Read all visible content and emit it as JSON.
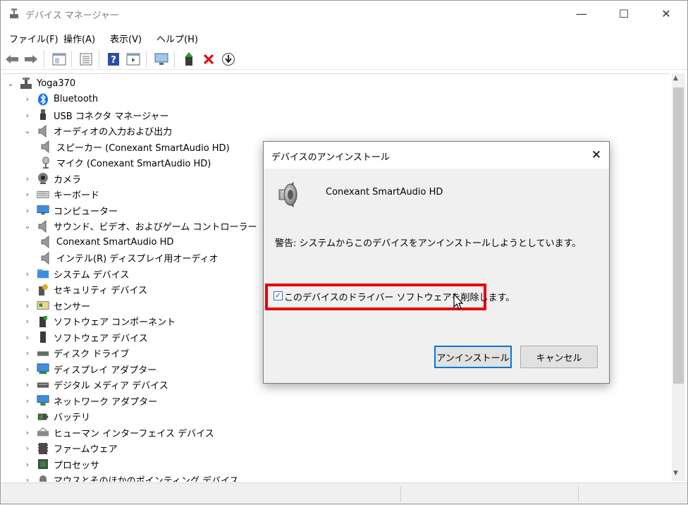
{
  "window": {
    "title": "デバイス マネージャー",
    "minimize": "—",
    "maximize": "☐",
    "close": "✕"
  },
  "menu": [
    "ファイル(F)",
    "操作(A)",
    "表示(V)",
    "ヘルプ(H)"
  ],
  "toolbar": [
    "back-icon",
    "forward-icon",
    "properties-pane-icon",
    "list-icon",
    "help-icon",
    "view-icon",
    "monitor-icon",
    "update-driver-icon",
    "uninstall-icon",
    "download-icon"
  ],
  "tree": {
    "root": "Yoga370",
    "items": [
      {
        "label": "Bluetooth",
        "icon": "bluetooth-icon",
        "expander": "›",
        "level": 1
      },
      {
        "label": "USB コネクタ マネージャー",
        "icon": "usb-icon",
        "expander": "›",
        "level": 1
      },
      {
        "label": "オーディオの入力および出力",
        "icon": "speaker-icon",
        "expander": "⌄",
        "level": 1
      },
      {
        "label": "スピーカー (Conexant SmartAudio HD)",
        "icon": "speaker-icon",
        "expander": "",
        "level": 2
      },
      {
        "label": "マイク (Conexant SmartAudio HD)",
        "icon": "microphone-icon",
        "expander": "",
        "level": 2
      },
      {
        "label": "カメラ",
        "icon": "camera-icon",
        "expander": "›",
        "level": 1
      },
      {
        "label": "キーボード",
        "icon": "keyboard-icon",
        "expander": "›",
        "level": 1
      },
      {
        "label": "コンピューター",
        "icon": "computer-icon",
        "expander": "›",
        "level": 1
      },
      {
        "label": "サウンド、ビデオ、およびゲーム コントローラー",
        "icon": "speaker-icon",
        "expander": "⌄",
        "level": 1
      },
      {
        "label": "Conexant SmartAudio HD",
        "icon": "speaker-icon",
        "expander": "",
        "level": 2
      },
      {
        "label": "インテル(R) ディスプレイ用オーディオ",
        "icon": "speaker-icon",
        "expander": "",
        "level": 2
      },
      {
        "label": "システム デバイス",
        "icon": "system-folder-icon",
        "expander": "›",
        "level": 1
      },
      {
        "label": "セキュリティ デバイス",
        "icon": "security-key-icon",
        "expander": "›",
        "level": 1
      },
      {
        "label": "センサー",
        "icon": "sensor-icon",
        "expander": "›",
        "level": 1
      },
      {
        "label": "ソフトウェア コンポーネント",
        "icon": "software-component-icon",
        "expander": "›",
        "level": 1
      },
      {
        "label": "ソフトウェア デバイス",
        "icon": "software-device-icon",
        "expander": "›",
        "level": 1
      },
      {
        "label": "ディスク ドライブ",
        "icon": "disk-drive-icon",
        "expander": "›",
        "level": 1
      },
      {
        "label": "ディスプレイ アダプター",
        "icon": "display-adapter-icon",
        "expander": "›",
        "level": 1
      },
      {
        "label": "デジタル メディア デバイス",
        "icon": "media-device-icon",
        "expander": "›",
        "level": 1
      },
      {
        "label": "ネットワーク アダプター",
        "icon": "network-icon",
        "expander": "›",
        "level": 1
      },
      {
        "label": "バッテリ",
        "icon": "battery-icon",
        "expander": "›",
        "level": 1
      },
      {
        "label": "ヒューマン インターフェイス デバイス",
        "icon": "hid-icon",
        "expander": "›",
        "level": 1
      },
      {
        "label": "ファームウェア",
        "icon": "firmware-icon",
        "expander": "›",
        "level": 1
      },
      {
        "label": "プロセッサ",
        "icon": "processor-icon",
        "expander": "›",
        "level": 1
      },
      {
        "label": "マウスとそのほかのポインティング デバイス",
        "icon": "mouse-icon",
        "expander": "›",
        "level": 1
      }
    ]
  },
  "dialog": {
    "title": "デバイスのアンインストール",
    "close": "✕",
    "device_name": "Conexant SmartAudio HD",
    "warning": "警告: システムからこのデバイスをアンインストールしようとしています。",
    "checkbox_label": "このデバイスのドライバー ソフトウェアを削除します。",
    "checkbox_checked": true,
    "checkbox_mark": "✓",
    "uninstall_button": "アンインストール",
    "cancel_button": "キャンセル",
    "highlight_color": "#e8000b"
  }
}
